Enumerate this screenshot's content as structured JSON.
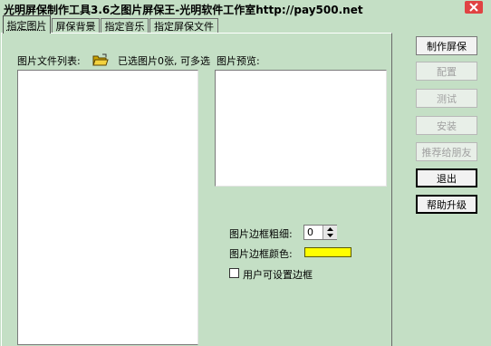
{
  "window": {
    "title": "光明屏保制作工具3.6之图片屏保王-光明软件工作室http://pay500.net",
    "close_glyph": "×"
  },
  "tabs": [
    {
      "label": "指定图片",
      "active": true
    },
    {
      "label": "屏保背景",
      "active": false
    },
    {
      "label": "指定音乐",
      "active": false
    },
    {
      "label": "指定屏保文件",
      "active": false
    }
  ],
  "picture_tab": {
    "file_list_label": "图片文件列表:",
    "selection_status": "已选图片0张, 可多选",
    "preview_label": "图片预览:",
    "border_width_label": "图片边框粗细:",
    "border_width_value": "0",
    "border_color_label": "图片边框颜色:",
    "border_color": "#ffff00",
    "user_border_checkbox_label": "用户可设置边框",
    "user_border_checked": false
  },
  "actions": {
    "make": "制作屏保",
    "configure": "配置",
    "test": "测试",
    "install": "安装",
    "recommend": "推荐给朋友",
    "exit": "退出",
    "help": "帮助升级"
  },
  "colors": {
    "background": "#c4dfc5",
    "list_background": "#ffffff",
    "disabled_text": "#a0a0a0"
  }
}
